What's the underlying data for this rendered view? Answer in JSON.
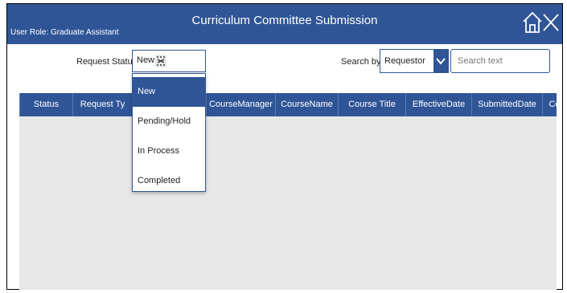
{
  "app": {
    "title": "Curriculum Committee Submission",
    "user_role": "User Role: Graduate Assistant"
  },
  "header_icons": [
    "home-icon",
    "close-icon"
  ],
  "filters": {
    "request_status_label": "Request Status:",
    "request_status_value": "New",
    "search_by_label": "Search by:",
    "search_by_value": "Requestor",
    "search_placeholder": "Search text"
  },
  "status_options": [
    "New",
    "Pending/Hold",
    "In Process",
    "Completed"
  ],
  "selected_status_index": 0,
  "table": {
    "columns": [
      "Status",
      "Request Ty",
      "",
      "CourseManager",
      "CourseName",
      "Course Title",
      "EffectiveDate",
      "SubmittedDate",
      "Ce"
    ],
    "rows": []
  },
  "colors": {
    "primary": "#2f5596",
    "table_body": "#e7e7e7",
    "header_text": "#ffffff"
  }
}
